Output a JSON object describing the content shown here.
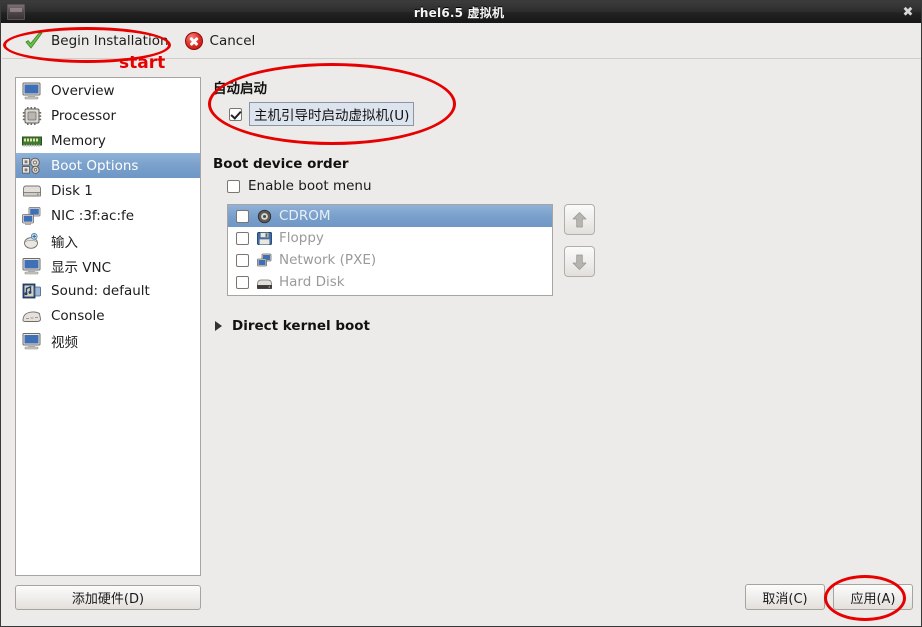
{
  "window": {
    "title": "rhel6.5 虚拟机",
    "icon": "vm-window-icon",
    "close_label": "✖"
  },
  "toolbar": {
    "begin_installation_label": "Begin Installation",
    "begin_installation_icon": "green-check-icon",
    "cancel_label": "Cancel",
    "cancel_icon": "red-x-icon"
  },
  "sidebar": {
    "items": [
      {
        "label": "Overview",
        "icon": "monitor-icon",
        "selected": false
      },
      {
        "label": "Processor",
        "icon": "cpu-icon",
        "selected": false
      },
      {
        "label": "Memory",
        "icon": "ram-icon",
        "selected": false
      },
      {
        "label": "Boot Options",
        "icon": "gears-icon",
        "selected": true
      },
      {
        "label": "Disk 1",
        "icon": "harddisk-icon",
        "selected": false
      },
      {
        "label": "NIC :3f:ac:fe",
        "icon": "network-icon",
        "selected": false
      },
      {
        "label": "输入",
        "icon": "mouse-icon",
        "selected": false
      },
      {
        "label": "显示  VNC",
        "icon": "display-icon",
        "selected": false
      },
      {
        "label": "Sound: default",
        "icon": "sound-icon",
        "selected": false
      },
      {
        "label": "Console",
        "icon": "console-icon",
        "selected": false
      },
      {
        "label": "视频",
        "icon": "video-icon",
        "selected": false
      }
    ],
    "add_hardware_label": "添加硬件(D)"
  },
  "main": {
    "autostart": {
      "section_title": "自动启动",
      "checkbox_label": "主机引导时启动虚拟机(U)",
      "checked": true
    },
    "boot_order": {
      "section_title": "Boot device order",
      "enable_boot_menu_label": "Enable boot menu",
      "enable_boot_menu_checked": false,
      "devices": [
        {
          "label": "CDROM",
          "icon": "cdrom-icon",
          "checked": false,
          "selected": true
        },
        {
          "label": "Floppy",
          "icon": "floppy-icon",
          "checked": false,
          "selected": false
        },
        {
          "label": "Network (PXE)",
          "icon": "network-icon",
          "checked": false,
          "selected": false
        },
        {
          "label": "Hard Disk",
          "icon": "harddisk-icon",
          "checked": false,
          "selected": false
        }
      ],
      "move_up_icon": "arrow-up-icon",
      "move_down_icon": "arrow-down-icon"
    },
    "direct_kernel_boot": {
      "label": "Direct kernel boot",
      "expanded": false,
      "icon": "expander-triangle-icon"
    }
  },
  "footer": {
    "cancel_label": "取消(C)",
    "apply_label": "应用(A)"
  },
  "annotations": {
    "start_text": "start",
    "color": "#e60000",
    "ellipses": [
      "begin-installation-highlight",
      "autostart-highlight",
      "apply-button-highlight"
    ]
  },
  "colors": {
    "window_bg": "#edebe9",
    "titlebar": "#232323",
    "selection_blue": "#7aa0cb",
    "annotation_red": "#e60000",
    "list_bg": "#ffffff"
  }
}
